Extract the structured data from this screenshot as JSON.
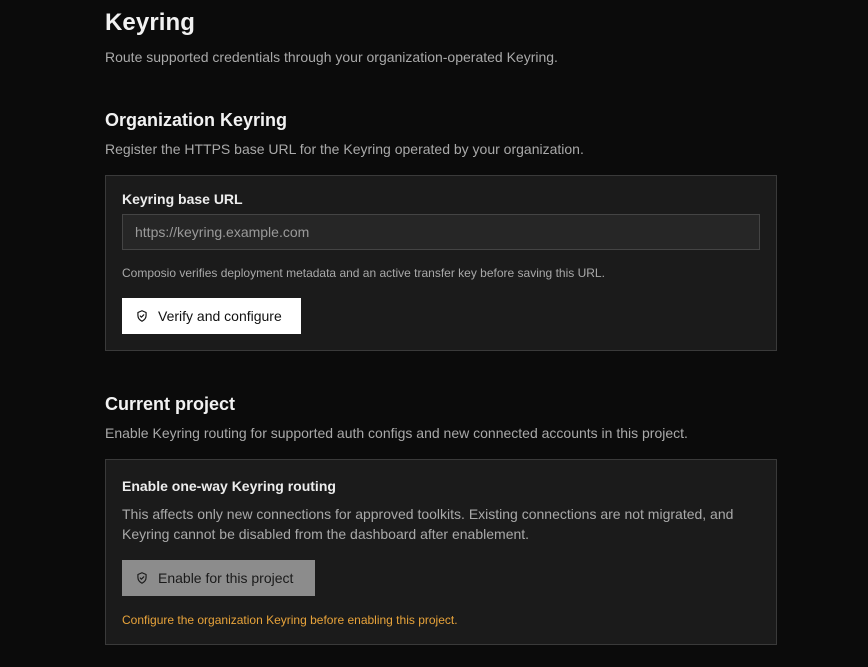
{
  "page": {
    "title": "Keyring",
    "subtitle": "Route supported credentials through your organization-operated Keyring."
  },
  "org_keyring": {
    "title": "Organization Keyring",
    "description": "Register the HTTPS base URL for the Keyring operated by your organization.",
    "field_label": "Keyring base URL",
    "url_value": "",
    "url_placeholder": "https://keyring.example.com",
    "hint": "Composio verifies deployment metadata and an active transfer key before saving this URL.",
    "button_label": "Verify and configure",
    "button_icon": "shield-check-icon"
  },
  "current_project": {
    "title": "Current project",
    "description": "Enable Keyring routing for supported auth configs and new connected accounts in this project.",
    "card_title": "Enable one-way Keyring routing",
    "warning": "This affects only new connections for approved toolkits. Existing connections are not migrated, and Keyring cannot be disabled from the dashboard after enablement.",
    "button_label": "Enable for this project",
    "button_icon": "shield-check-icon",
    "button_disabled": true,
    "notice": "Configure the organization Keyring before enabling this project.",
    "notice_color": "#e8a33a"
  }
}
